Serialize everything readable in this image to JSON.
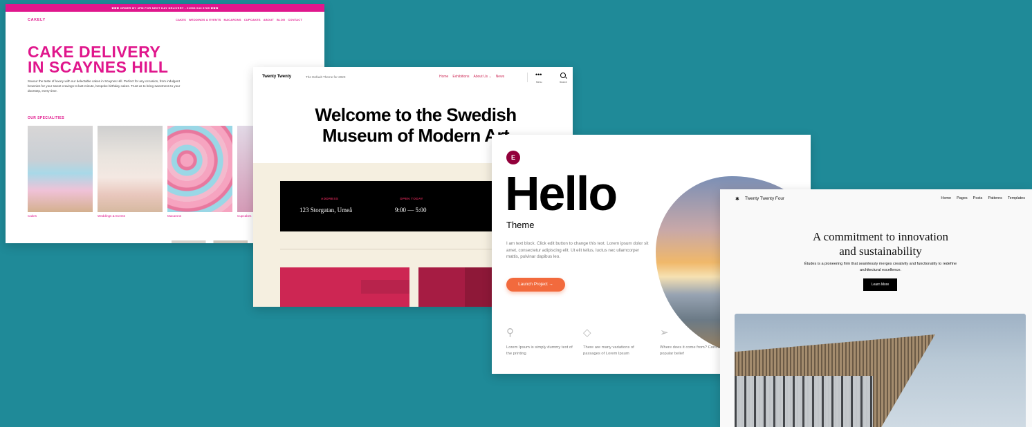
{
  "cakely": {
    "announcement": "✿✿✿ ORDER BY 4PM FOR NEXT DAY DELIVERY - 01903 043 6789 ✿✿✿",
    "logo": "CAKELY",
    "menu": [
      "CAKES",
      "WEDDINGS & EVENTS",
      "MACARONS",
      "CUPCAKES",
      "ABOUT",
      "BLOG",
      "CONTACT"
    ],
    "headline_line1": "CAKE DELIVERY",
    "headline_line2": "IN SCAYNES HILL",
    "intro": "Savour the taste of luxury with our delectable cakes in Scaynes Hill. Perfect for any occasion, from indulgent brownies for your sweet cravings to last-minute, bespoke birthday cakes. Trust us to bring sweetness to your doorstep, every time.",
    "specialities_heading": "OUR SPECIALITIES",
    "tiles": [
      "Cakes",
      "Weddings & Events",
      "Macarons",
      "Cupcakes"
    ],
    "brand_color": "#e0168c"
  },
  "twentytwenty": {
    "brand": "Twenty Twenty",
    "tagline": "The Default Theme for 2020",
    "menu": [
      "Home",
      "Exhibitions",
      "About Us ⌄",
      "News"
    ],
    "menu_toggle_label": "Menu",
    "search_label": "Search",
    "headline_line1": "Welcome to the Swedish",
    "headline_line2": "Museum of Modern Art",
    "address_label": "ADDRESS",
    "address_value": "123 Storgatan, Umeå",
    "hours_label": "OPEN TODAY",
    "hours_value": "9:00 — 5:00",
    "accent_color": "#cd2653"
  },
  "hello": {
    "logo_glyph": "E",
    "title": "Hello",
    "subtitle": "Theme",
    "body": "I am text block. Click edit button to change this text. Lorem ipsum dolor sit amet, consectetur adipiscing elit. Ut elit tellus, luctus nec ullamcorper mattis, pulvinar dapibus leo.",
    "cta": "Launch Project →",
    "features": [
      {
        "icon": "lightbulb-icon",
        "glyph": "💡",
        "text": "Lorem Ipsum is simply dummy text of the printing"
      },
      {
        "icon": "diamond-icon",
        "glyph": "◇",
        "text": "There are many variations of passages of Lorem Ipsum"
      },
      {
        "icon": "paper-plane-icon",
        "glyph": "➢",
        "text": "Where does it come from? Contrary to popular belief"
      }
    ],
    "accent_color": "#f26a3d"
  },
  "tt4": {
    "logo_glyph": "✱",
    "brand": "Twenty Twenty Four",
    "menu": [
      "Home",
      "Pages",
      "Posts",
      "Patterns",
      "Templates"
    ],
    "headline_line1": "A commitment to innovation",
    "headline_line2": "and sustainability",
    "body": "Études is a pioneering firm that seamlessly merges creativity and functionality to redefine architectural excellence.",
    "button": "Learn More"
  }
}
